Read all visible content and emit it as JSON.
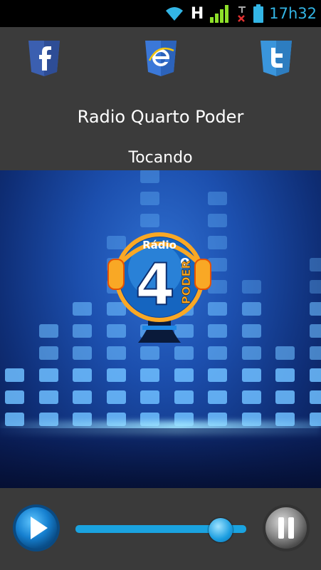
{
  "status_bar": {
    "time": "17h32",
    "network_label": "H",
    "icons": [
      "wifi-icon",
      "signal-icon",
      "no-sim-icon",
      "battery-icon"
    ],
    "accent_color": "#33b5e5"
  },
  "social": {
    "items": [
      "facebook-icon",
      "internet-explorer-icon",
      "twitter-icon"
    ]
  },
  "station": {
    "title": "Radio Quarto Poder",
    "status": "Tocando"
  },
  "logo": {
    "top_text": "Rádio",
    "number": "4",
    "ordinal": "º",
    "side_text": "PODER"
  },
  "player": {
    "play_icon": "play-icon",
    "pause_icon": "pause-icon",
    "volume_level": 0.85
  }
}
